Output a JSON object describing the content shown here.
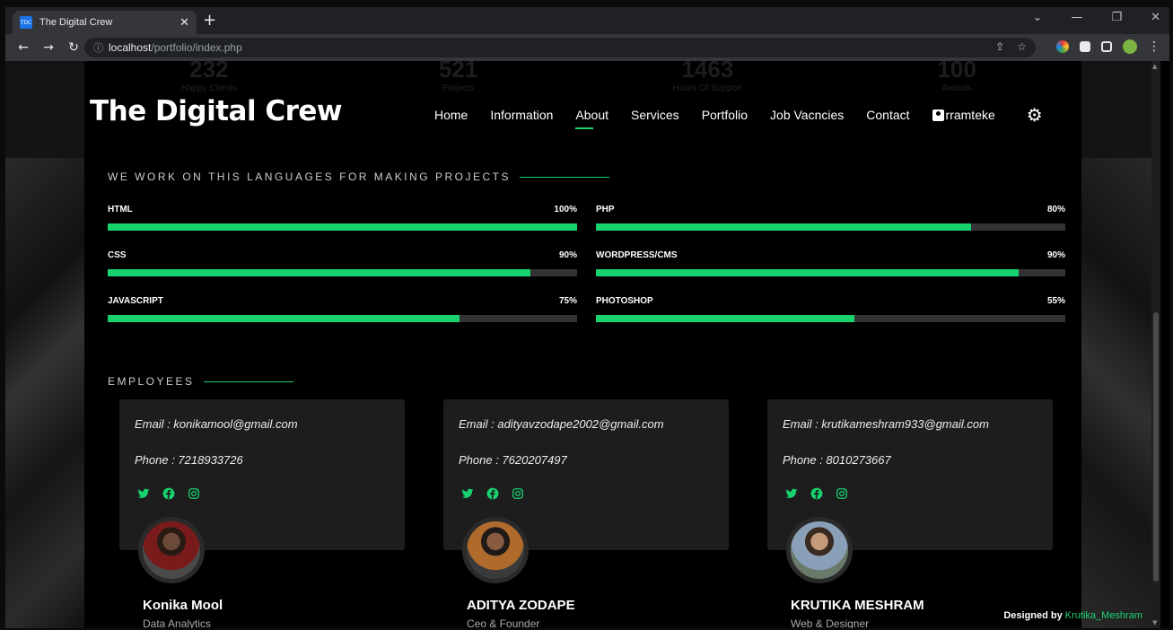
{
  "browser": {
    "tab_title": "The Digital Crew",
    "favicon_text": "TDC",
    "url_host": "localhost",
    "url_path": "/portfolio/index.php"
  },
  "counters": [
    {
      "number": "232",
      "label": "Happy Clients"
    },
    {
      "number": "521",
      "label": "Projects"
    },
    {
      "number": "1463",
      "label": "Hours Of Support"
    },
    {
      "number": "100",
      "label": "Awards"
    }
  ],
  "header": {
    "brand": "The Digital Crew",
    "nav": [
      "Home",
      "Information",
      "About",
      "Services",
      "Portfolio",
      "Job Vacncies",
      "Contact"
    ],
    "active_nav": "About",
    "user": "rramteke"
  },
  "skills_section": {
    "title": "WE WORK ON THIS LANGUAGES FOR MAKING PROJECTS",
    "skills": [
      {
        "name": "HTML",
        "percent_label": "100%",
        "value": 100
      },
      {
        "name": "PHP",
        "percent_label": "80%",
        "value": 80
      },
      {
        "name": "CSS",
        "percent_label": "90%",
        "value": 90
      },
      {
        "name": "WORDPRESS/CMS",
        "percent_label": "90%",
        "value": 90
      },
      {
        "name": "JAVASCRIPT",
        "percent_label": "75%",
        "value": 75
      },
      {
        "name": "PHOTOSHOP",
        "percent_label": "55%",
        "value": 55
      }
    ]
  },
  "employees_section": {
    "title": "EMPLOYEES",
    "employees": [
      {
        "email": "Email : konikamool@gmail.com",
        "phone": "Phone : 7218933726",
        "name": "Konika Mool",
        "role": "Data Analytics"
      },
      {
        "email": "Email : adityavzodape2002@gmail.com",
        "phone": "Phone : 7620207497",
        "name": "ADITYA ZODAPE",
        "role": "Ceo & Founder"
      },
      {
        "email": "Email : krutikameshram933@gmail.com",
        "phone": "Phone : 8010273667",
        "name": "KRUTIKA MESHRAM",
        "role": "Web & Designer"
      }
    ]
  },
  "footer": {
    "designed_by": "Designed by",
    "designer": "Krutika_Meshram"
  },
  "colors": {
    "accent": "#18d26e",
    "card": "#1d1d1d",
    "background": "#000000"
  }
}
